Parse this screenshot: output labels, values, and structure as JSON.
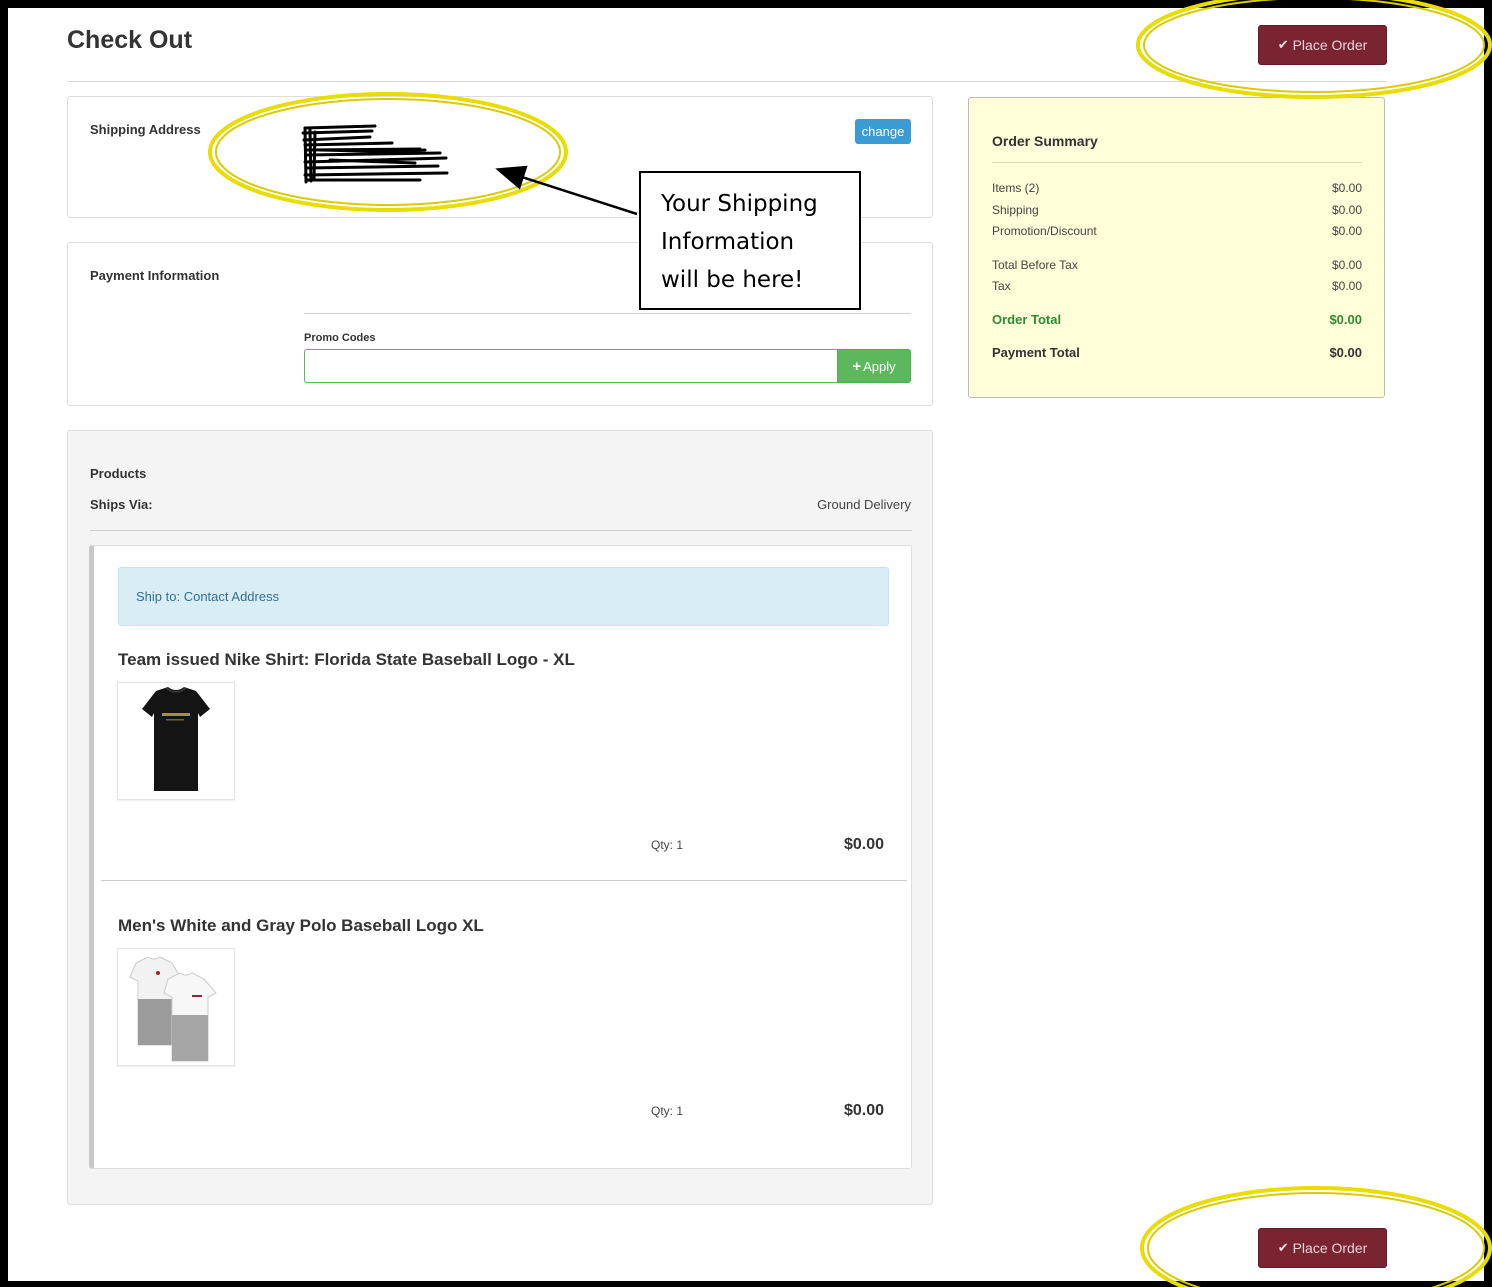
{
  "page": {
    "title": "Check Out"
  },
  "actions": {
    "place_order_label": "Place Order",
    "check_glyph": "✔"
  },
  "shipping": {
    "label": "Shipping Address",
    "change_label": "change"
  },
  "payment": {
    "label": "Payment Information",
    "promo_label": "Promo Codes",
    "promo_value": "",
    "apply_label": "Apply",
    "apply_glyph": "+"
  },
  "summary": {
    "title": "Order Summary",
    "rows": [
      {
        "label": "Items (2)",
        "value": "$0.00"
      },
      {
        "label": "Shipping",
        "value": "$0.00"
      },
      {
        "label": "Promotion/Discount",
        "value": "$0.00"
      },
      {
        "label": "Total Before Tax",
        "value": "$0.00"
      },
      {
        "label": "Tax",
        "value": "$0.00"
      }
    ],
    "order_total": {
      "label": "Order Total",
      "value": "$0.00"
    },
    "payment_total": {
      "label": "Payment Total",
      "value": "$0.00"
    }
  },
  "products": {
    "label": "Products",
    "ships_via_label": "Ships Via:",
    "ships_via_value": "Ground Delivery",
    "ship_to": "Ship to: Contact Address",
    "items": [
      {
        "name": "Team issued Nike Shirt: Florida State Baseball Logo - XL",
        "qty": "Qty: 1",
        "price": "$0.00"
      },
      {
        "name": "Men's White and Gray Polo Baseball Logo XL",
        "qty": "Qty: 1",
        "price": "$0.00"
      }
    ]
  },
  "annotation": {
    "callout_lines": [
      "Your Shipping",
      "Information",
      "will be here!"
    ],
    "highlight_color": "#f2e600"
  },
  "colors": {
    "place_order": "#7a2432",
    "apply": "#5cb85c",
    "change": "#3a9bd5",
    "summary_bg": "#fffed8",
    "total_green": "#2e8b2e"
  }
}
